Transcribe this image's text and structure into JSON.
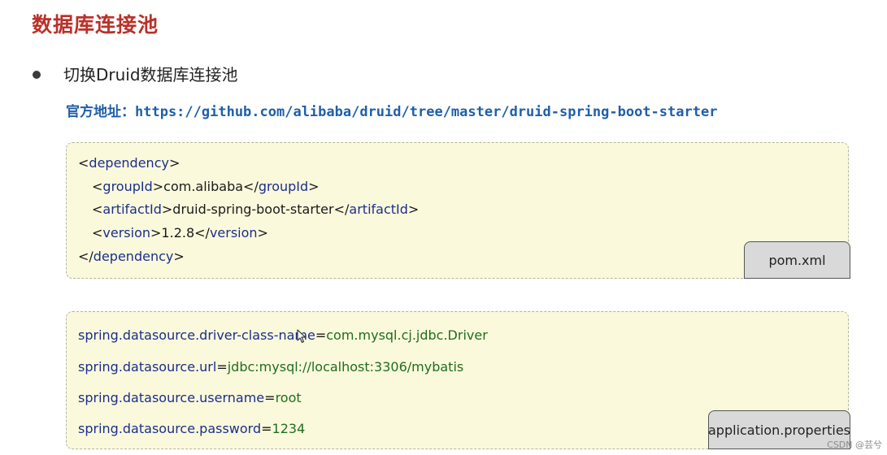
{
  "title": "数据库连接池",
  "bullet": {
    "text": "切换Druid数据库连接池"
  },
  "official_site": {
    "label": "官方地址：",
    "url": "https://github.com/alibaba/druid/tree/master/druid-spring-boot-starter"
  },
  "pom_snippet": {
    "filename": "pom.xml",
    "lines": [
      {
        "open": "dependency",
        "content": "",
        "close": ""
      },
      {
        "open": "groupId",
        "content": "com.alibaba",
        "close": "groupId"
      },
      {
        "open": "artifactId",
        "content": "druid-spring-boot-starter",
        "close": "artifactId"
      },
      {
        "open": "version",
        "content": "1.2.8",
        "close": "version"
      },
      {
        "open": "",
        "content": "",
        "close": "dependency"
      }
    ]
  },
  "properties_snippet": {
    "filename": "application.properties",
    "entries": [
      {
        "key": "spring.datasource.driver-class-name",
        "value": "com.mysql.cj.jdbc.Driver"
      },
      {
        "key": "spring.datasource.url",
        "value": "jdbc:mysql://localhost:3306/mybatis"
      },
      {
        "key": "spring.datasource.username",
        "value": "root"
      },
      {
        "key": "spring.datasource.password",
        "value": "1234"
      }
    ]
  },
  "watermark": "CSDN @芸兮",
  "colors": {
    "title": "#b8322a",
    "link": "#1f5fa8",
    "tag": "#1a2f8a",
    "property_value": "#1e6e1e",
    "code_background": "#fbf9dc",
    "file_tab": "#d9d9d9"
  }
}
